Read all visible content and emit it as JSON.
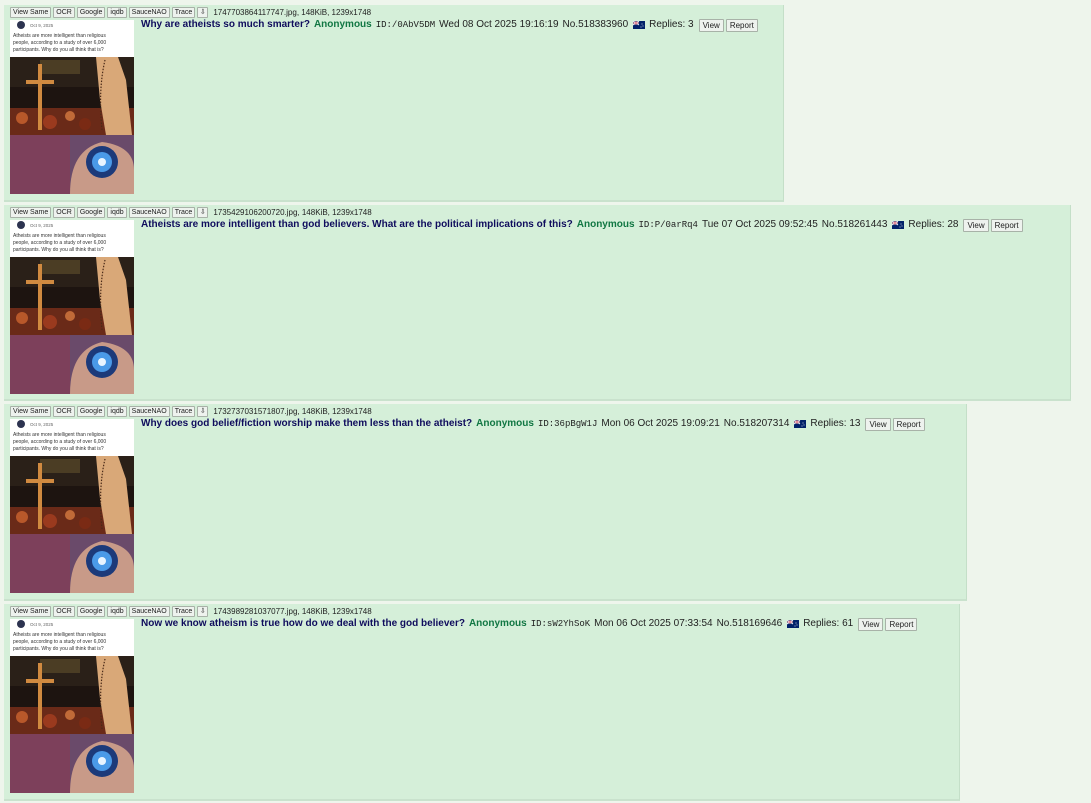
{
  "file_buttons": [
    "View Same",
    "OCR",
    "Google",
    "iqdb",
    "SauceNAO",
    "Trace"
  ],
  "download_glyph": "⇩",
  "thumb_caption": {
    "handle": "Oct 9, 2025",
    "text_lines": [
      "Atheists are more intelligent than religious",
      "people, according to a study of over 6,000",
      "participants. Why do you all think that is?"
    ]
  },
  "flag_colors": {
    "blue": "#012169",
    "red": "#c8102e",
    "white": "#ffffff"
  },
  "threads": [
    {
      "file": "1747703864117747.jpg, 148KiB, 1239x1748",
      "subject": "Why are atheists so much smarter?",
      "name": "Anonymous",
      "poster_id": "ID:/0AbV5DM",
      "date": "Wed 08 Oct 2025 19:16:19",
      "post_no": "No.518383960",
      "replies": "Replies: 3",
      "view": "View",
      "report": "Report"
    },
    {
      "file": "1735429106200720.jpg, 148KiB, 1239x1748",
      "subject": "Atheists are more intelligent than god believers. What are the political implications of this?",
      "name": "Anonymous",
      "poster_id": "ID:P/0arRq4",
      "date": "Tue 07 Oct 2025 09:52:45",
      "post_no": "No.518261443",
      "replies": "Replies: 28",
      "view": "View",
      "report": "Report"
    },
    {
      "file": "1732737031571807.jpg, 148KiB, 1239x1748",
      "subject": "Why does god belief/fiction worship make them less than the atheist?",
      "name": "Anonymous",
      "poster_id": "ID:36pBgW1J",
      "date": "Mon 06 Oct 2025 19:09:21",
      "post_no": "No.518207314",
      "replies": "Replies: 13",
      "view": "View",
      "report": "Report"
    },
    {
      "file": "1743989281037077.jpg, 148KiB, 1239x1748",
      "subject": "Now we know atheism is true how do we deal with the god believer?",
      "name": "Anonymous",
      "poster_id": "ID:sW2YhSoK",
      "date": "Mon 06 Oct 2025 07:33:54",
      "post_no": "No.518169646",
      "replies": "Replies: 61",
      "view": "View",
      "report": "Report"
    }
  ]
}
